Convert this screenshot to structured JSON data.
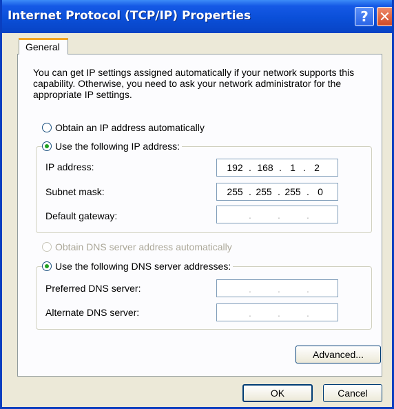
{
  "window": {
    "title": "Internet Protocol (TCP/IP) Properties",
    "help_glyph": "?",
    "close_glyph": "✕"
  },
  "tabs": [
    {
      "label": "General"
    }
  ],
  "description": "You can get IP settings assigned automatically if your network supports this capability. Otherwise, you need to ask your network administrator for the appropriate IP settings.",
  "ip_mode": {
    "auto_label": "Obtain an IP address automatically",
    "manual_label": "Use the following IP address:",
    "selected": "manual"
  },
  "ip": {
    "address_label": "IP address:",
    "address": [
      "192",
      "168",
      "1",
      "2"
    ],
    "subnet_label": "Subnet mask:",
    "subnet": [
      "255",
      "255",
      "255",
      "0"
    ],
    "gateway_label": "Default gateway:",
    "gateway": [
      "",
      "",
      "",
      ""
    ]
  },
  "dns_mode": {
    "auto_label": "Obtain DNS server address automatically",
    "manual_label": "Use the following DNS server addresses:",
    "selected": "manual"
  },
  "dns": {
    "preferred_label": "Preferred DNS server:",
    "preferred": [
      "",
      "",
      "",
      ""
    ],
    "alternate_label": "Alternate DNS server:",
    "alternate": [
      "",
      "",
      "",
      ""
    ]
  },
  "buttons": {
    "advanced": "Advanced...",
    "ok": "OK",
    "cancel": "Cancel"
  }
}
